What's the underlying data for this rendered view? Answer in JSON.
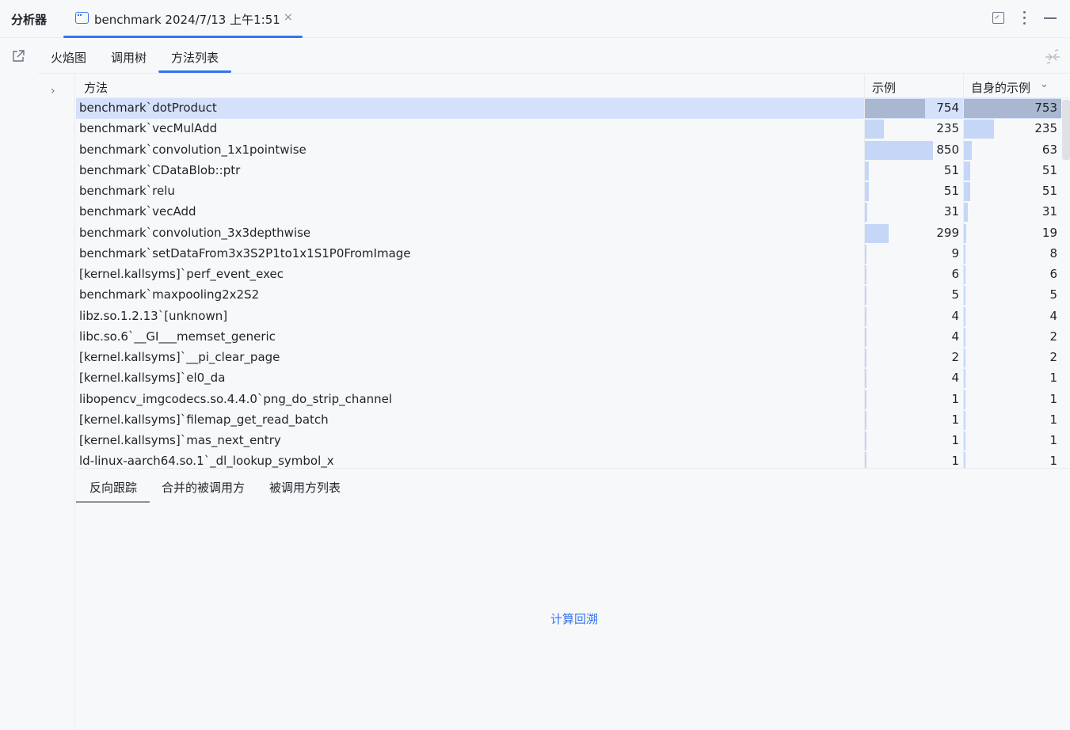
{
  "app": {
    "title": "分析器"
  },
  "doc_tab": {
    "label": "benchmark 2024/7/13 上午1:51",
    "close": "×"
  },
  "view_tabs": [
    {
      "label": "火焰图"
    },
    {
      "label": "调用树"
    },
    {
      "label": "方法列表"
    }
  ],
  "table": {
    "headers": {
      "method": "方法",
      "samples": "示例",
      "self_samples": "自身的示例"
    },
    "rows": [
      {
        "method": "benchmark`dotProduct",
        "samples": 754,
        "self": 753,
        "selected": true
      },
      {
        "method": "benchmark`vecMulAdd",
        "samples": 235,
        "self": 235
      },
      {
        "method": "benchmark`convolution_1x1pointwise",
        "samples": 850,
        "self": 63
      },
      {
        "method": "benchmark`CDataBlob::ptr",
        "samples": 51,
        "self": 51
      },
      {
        "method": "benchmark`relu",
        "samples": 51,
        "self": 51
      },
      {
        "method": "benchmark`vecAdd",
        "samples": 31,
        "self": 31
      },
      {
        "method": "benchmark`convolution_3x3depthwise",
        "samples": 299,
        "self": 19
      },
      {
        "method": "benchmark`setDataFrom3x3S2P1to1x1S1P0FromImage",
        "samples": 9,
        "self": 8
      },
      {
        "method": "[kernel.kallsyms]`perf_event_exec",
        "samples": 6,
        "self": 6
      },
      {
        "method": "benchmark`maxpooling2x2S2",
        "samples": 5,
        "self": 5
      },
      {
        "method": "libz.so.1.2.13`[unknown]",
        "samples": 4,
        "self": 4
      },
      {
        "method": "libc.so.6`__GI___memset_generic",
        "samples": 4,
        "self": 2
      },
      {
        "method": "[kernel.kallsyms]`__pi_clear_page",
        "samples": 2,
        "self": 2
      },
      {
        "method": "[kernel.kallsyms]`el0_da",
        "samples": 4,
        "self": 1
      },
      {
        "method": "libopencv_imgcodecs.so.4.4.0`png_do_strip_channel",
        "samples": 1,
        "self": 1
      },
      {
        "method": "[kernel.kallsyms]`filemap_get_read_batch",
        "samples": 1,
        "self": 1
      },
      {
        "method": "[kernel.kallsyms]`mas_next_entry",
        "samples": 1,
        "self": 1
      },
      {
        "method": "ld-linux-aarch64.so.1`_dl_lookup_symbol_x",
        "samples": 1,
        "self": 1
      }
    ]
  },
  "bottom_tabs": [
    {
      "label": "反向跟踪"
    },
    {
      "label": "合并的被调用方"
    },
    {
      "label": "被调用方列表"
    }
  ],
  "backtrace": {
    "compute_link": "计算回溯"
  },
  "colors": {
    "accent": "#3574f0",
    "bar": "#c5d6f7",
    "bar_selected": "#a9b7d0",
    "row_selected": "#d5e1fb"
  }
}
